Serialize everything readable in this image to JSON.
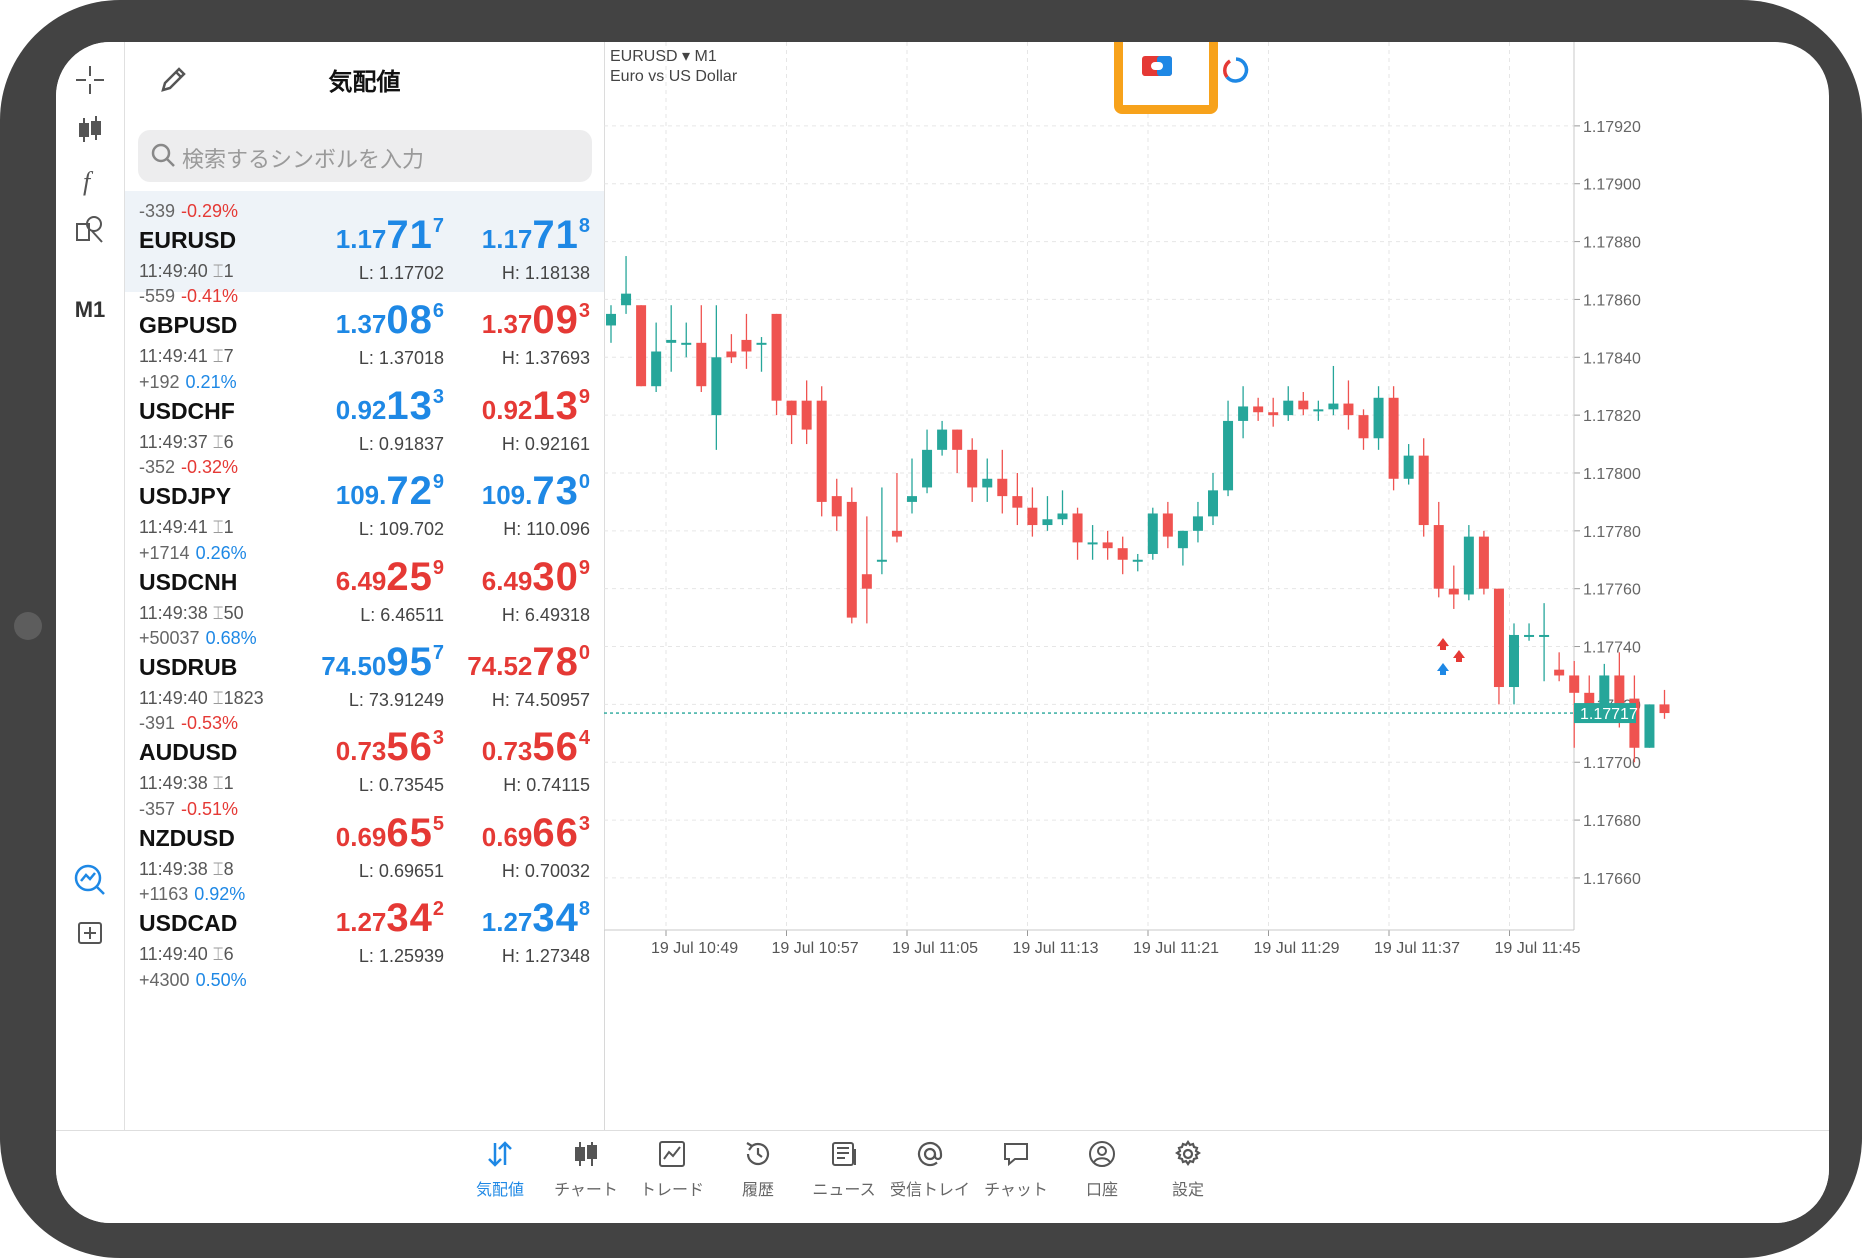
{
  "watchlist": {
    "title": "気配値",
    "search_placeholder": "検索するシンボルを入力",
    "rows": [
      {
        "change_points": "-339",
        "change_pct": "-0.29%",
        "pct_color": "red",
        "symbol": "EURUSD",
        "time": "11:49:40",
        "spread": "1",
        "bid": {
          "a": "1.17",
          "b": "71",
          "c": "7"
        },
        "ask": {
          "a": "1.17",
          "b": "71",
          "c": "8"
        },
        "bid_color": "blue",
        "ask_color": "blue",
        "low": "L: 1.17702",
        "high": "H: 1.18138",
        "selected": true
      },
      {
        "change_points": "-559",
        "change_pct": "-0.41%",
        "pct_color": "red",
        "symbol": "GBPUSD",
        "time": "11:49:41",
        "spread": "7",
        "bid": {
          "a": "1.37",
          "b": "08",
          "c": "6"
        },
        "ask": {
          "a": "1.37",
          "b": "09",
          "c": "3"
        },
        "bid_color": "blue",
        "ask_color": "red",
        "low": "L: 1.37018",
        "high": "H: 1.37693"
      },
      {
        "change_points": "+192",
        "change_pct": "0.21%",
        "pct_color": "blue",
        "symbol": "USDCHF",
        "time": "11:49:37",
        "spread": "6",
        "bid": {
          "a": "0.92",
          "b": "13",
          "c": "3"
        },
        "ask": {
          "a": "0.92",
          "b": "13",
          "c": "9"
        },
        "bid_color": "blue",
        "ask_color": "red",
        "low": "L: 0.91837",
        "high": "H: 0.92161"
      },
      {
        "change_points": "-352",
        "change_pct": "-0.32%",
        "pct_color": "red",
        "symbol": "USDJPY",
        "time": "11:49:41",
        "spread": "1",
        "bid": {
          "a": "109.",
          "b": "72",
          "c": "9"
        },
        "ask": {
          "a": "109.",
          "b": "73",
          "c": "0"
        },
        "bid_color": "blue",
        "ask_color": "blue",
        "low": "L: 109.702",
        "high": "H: 110.096"
      },
      {
        "change_points": "+1714",
        "change_pct": "0.26%",
        "pct_color": "blue",
        "symbol": "USDCNH",
        "time": "11:49:38",
        "spread": "50",
        "bid": {
          "a": "6.49",
          "b": "25",
          "c": "9"
        },
        "ask": {
          "a": "6.49",
          "b": "30",
          "c": "9"
        },
        "bid_color": "red",
        "ask_color": "red",
        "low": "L: 6.46511",
        "high": "H: 6.49318"
      },
      {
        "change_points": "+50037",
        "change_pct": "0.68%",
        "pct_color": "blue",
        "symbol": "USDRUB",
        "time": "11:49:40",
        "spread": "1823",
        "bid": {
          "a": "74.50",
          "b": "95",
          "c": "7"
        },
        "ask": {
          "a": "74.52",
          "b": "78",
          "c": "0"
        },
        "bid_color": "blue",
        "ask_color": "red",
        "low": "L: 73.91249",
        "high": "H: 74.50957"
      },
      {
        "change_points": "-391",
        "change_pct": "-0.53%",
        "pct_color": "red",
        "symbol": "AUDUSD",
        "time": "11:49:38",
        "spread": "1",
        "bid": {
          "a": "0.73",
          "b": "56",
          "c": "3"
        },
        "ask": {
          "a": "0.73",
          "b": "56",
          "c": "4"
        },
        "bid_color": "red",
        "ask_color": "red",
        "low": "L: 0.73545",
        "high": "H: 0.74115"
      },
      {
        "change_points": "-357",
        "change_pct": "-0.51%",
        "pct_color": "red",
        "symbol": "NZDUSD",
        "time": "11:49:38",
        "spread": "8",
        "bid": {
          "a": "0.69",
          "b": "65",
          "c": "5"
        },
        "ask": {
          "a": "0.69",
          "b": "66",
          "c": "3"
        },
        "bid_color": "red",
        "ask_color": "red",
        "low": "L: 0.69651",
        "high": "H: 0.70032"
      },
      {
        "change_points": "+1163",
        "change_pct": "0.92%",
        "pct_color": "blue",
        "symbol": "USDCAD",
        "time": "11:49:40",
        "spread": "6",
        "bid": {
          "a": "1.27",
          "b": "34",
          "c": "2"
        },
        "ask": {
          "a": "1.27",
          "b": "34",
          "c": "8"
        },
        "bid_color": "red",
        "ask_color": "blue",
        "low": "L: 1.25939",
        "high": "H: 1.27348"
      },
      {
        "change_points": "+4300",
        "change_pct": "0.50%",
        "pct_color": "blue",
        "symbol": "",
        "time": "",
        "spread": "",
        "bid": {
          "a": "",
          "b": "",
          "c": ""
        },
        "ask": {
          "a": "",
          "b": "",
          "c": ""
        },
        "bid_color": "blue",
        "ask_color": "blue",
        "low": "",
        "high": ""
      }
    ]
  },
  "left_toolbar": {
    "timeframe": "M1"
  },
  "chart": {
    "symbol": "EURUSD",
    "timeframe": "M1",
    "description": "Euro vs US Dollar",
    "current_price": "1.17717",
    "colors": {
      "bull": "#26a69a",
      "bear": "#ef5350",
      "grid": "#e6e6e6",
      "price_line": "#26a69a",
      "highlight": "#f7a21b"
    }
  },
  "chart_data": {
    "type": "candlestick",
    "y_ticks": [
      "1.17920",
      "1.17900",
      "1.17880",
      "1.17860",
      "1.17840",
      "1.17820",
      "1.17800",
      "1.17780",
      "1.17760",
      "1.17740",
      "1.17720",
      "1.17700",
      "1.17680",
      "1.17660"
    ],
    "ylim": [
      1.17642,
      1.17949
    ],
    "x_ticks": [
      "19 Jul 10:49",
      "19 Jul 10:57",
      "19 Jul 11:05",
      "19 Jul 11:13",
      "19 Jul 11:21",
      "19 Jul 11:29",
      "19 Jul 11:37",
      "19 Jul 11:45"
    ],
    "grid": true,
    "candles": [
      [
        1.17851,
        1.17858,
        1.17855,
        1.17845
      ],
      [
        1.17858,
        1.17875,
        1.17862,
        1.17855
      ],
      [
        1.17858,
        1.17858,
        1.1783,
        1.1783
      ],
      [
        1.1783,
        1.17852,
        1.17842,
        1.17828
      ],
      [
        1.17845,
        1.17858,
        1.17846,
        1.17835
      ],
      [
        1.17845,
        1.17852,
        1.17845,
        1.1784
      ],
      [
        1.17845,
        1.17858,
        1.1783,
        1.17828
      ],
      [
        1.1782,
        1.17858,
        1.1784,
        1.17808
      ],
      [
        1.17842,
        1.17848,
        1.1784,
        1.17838
      ],
      [
        1.17846,
        1.17855,
        1.17842,
        1.17836
      ],
      [
        1.17845,
        1.17847,
        1.17845,
        1.17835
      ],
      [
        1.17855,
        1.17855,
        1.17825,
        1.1782
      ],
      [
        1.17825,
        1.17825,
        1.1782,
        1.1781
      ],
      [
        1.17825,
        1.17832,
        1.17815,
        1.1781
      ],
      [
        1.17825,
        1.1783,
        1.1779,
        1.17785
      ],
      [
        1.17792,
        1.17798,
        1.17785,
        1.1778
      ],
      [
        1.1779,
        1.17795,
        1.1775,
        1.17748
      ],
      [
        1.17765,
        1.17785,
        1.1776,
        1.17748
      ],
      [
        1.1777,
        1.17795,
        1.1777,
        1.17765
      ],
      [
        1.1778,
        1.178,
        1.17778,
        1.17776
      ],
      [
        1.1779,
        1.17805,
        1.17792,
        1.17786
      ],
      [
        1.17795,
        1.17815,
        1.17808,
        1.17793
      ],
      [
        1.17808,
        1.17818,
        1.17815,
        1.17806
      ],
      [
        1.17815,
        1.17815,
        1.17808,
        1.178
      ],
      [
        1.17808,
        1.17812,
        1.17795,
        1.1779
      ],
      [
        1.17795,
        1.17805,
        1.17798,
        1.1779
      ],
      [
        1.17798,
        1.17808,
        1.17792,
        1.17786
      ],
      [
        1.17792,
        1.178,
        1.17788,
        1.17782
      ],
      [
        1.17788,
        1.17795,
        1.17782,
        1.17778
      ],
      [
        1.17782,
        1.17792,
        1.17784,
        1.1778
      ],
      [
        1.17784,
        1.17794,
        1.17786,
        1.17782
      ],
      [
        1.17786,
        1.17788,
        1.17776,
        1.1777
      ],
      [
        1.17776,
        1.17782,
        1.17776,
        1.1777
      ],
      [
        1.17776,
        1.1778,
        1.17774,
        1.1777
      ],
      [
        1.17774,
        1.17778,
        1.1777,
        1.17765
      ],
      [
        1.1777,
        1.17772,
        1.1777,
        1.17766
      ],
      [
        1.17772,
        1.17788,
        1.17786,
        1.1777
      ],
      [
        1.17786,
        1.1779,
        1.17778,
        1.17774
      ],
      [
        1.17774,
        1.1778,
        1.1778,
        1.17768
      ],
      [
        1.1778,
        1.1779,
        1.17785,
        1.17776
      ],
      [
        1.17785,
        1.178,
        1.17794,
        1.17782
      ],
      [
        1.17794,
        1.17825,
        1.17818,
        1.17792
      ],
      [
        1.17818,
        1.1783,
        1.17823,
        1.17812
      ],
      [
        1.17823,
        1.17826,
        1.17821,
        1.17818
      ],
      [
        1.17821,
        1.17826,
        1.1782,
        1.17816
      ],
      [
        1.1782,
        1.1783,
        1.17825,
        1.17818
      ],
      [
        1.17825,
        1.17828,
        1.17822,
        1.1782
      ],
      [
        1.17822,
        1.17825,
        1.17822,
        1.17818
      ],
      [
        1.17822,
        1.17837,
        1.17824,
        1.1782
      ],
      [
        1.17824,
        1.17832,
        1.1782,
        1.17815
      ],
      [
        1.1782,
        1.17822,
        1.17812,
        1.17808
      ],
      [
        1.17812,
        1.1783,
        1.17826,
        1.17808
      ],
      [
        1.17826,
        1.1783,
        1.17798,
        1.17794
      ],
      [
        1.17798,
        1.1781,
        1.17806,
        1.17796
      ],
      [
        1.17806,
        1.17812,
        1.17782,
        1.17778
      ],
      [
        1.17782,
        1.1779,
        1.1776,
        1.17757
      ],
      [
        1.1776,
        1.17768,
        1.17758,
        1.17753
      ],
      [
        1.17758,
        1.17782,
        1.17778,
        1.17756
      ],
      [
        1.17778,
        1.1778,
        1.1776,
        1.17758
      ],
      [
        1.1776,
        1.1776,
        1.17726,
        1.1772
      ],
      [
        1.17726,
        1.17748,
        1.17744,
        1.1772
      ],
      [
        1.17744,
        1.17748,
        1.17744,
        1.17742
      ],
      [
        1.17744,
        1.17755,
        1.17744,
        1.17728
      ],
      [
        1.17732,
        1.17738,
        1.1773,
        1.17728
      ],
      [
        1.1773,
        1.17735,
        1.17724,
        1.17705
      ],
      [
        1.17724,
        1.1773,
        1.1772,
        1.17715
      ],
      [
        1.1772,
        1.17734,
        1.1773,
        1.17718
      ],
      [
        1.1773,
        1.17738,
        1.1772,
        1.17712
      ],
      [
        1.17722,
        1.1773,
        1.17705,
        1.177
      ],
      [
        1.17705,
        1.1772,
        1.1772,
        1.17705
      ],
      [
        1.1772,
        1.17725,
        1.17717,
        1.17715
      ]
    ]
  },
  "tabs": [
    {
      "label": "気配値",
      "active": true
    },
    {
      "label": "チャート"
    },
    {
      "label": "トレード"
    },
    {
      "label": "履歴"
    },
    {
      "label": "ニュース"
    },
    {
      "label": "受信トレイ"
    },
    {
      "label": "チャット"
    },
    {
      "label": "口座"
    },
    {
      "label": "設定"
    }
  ]
}
